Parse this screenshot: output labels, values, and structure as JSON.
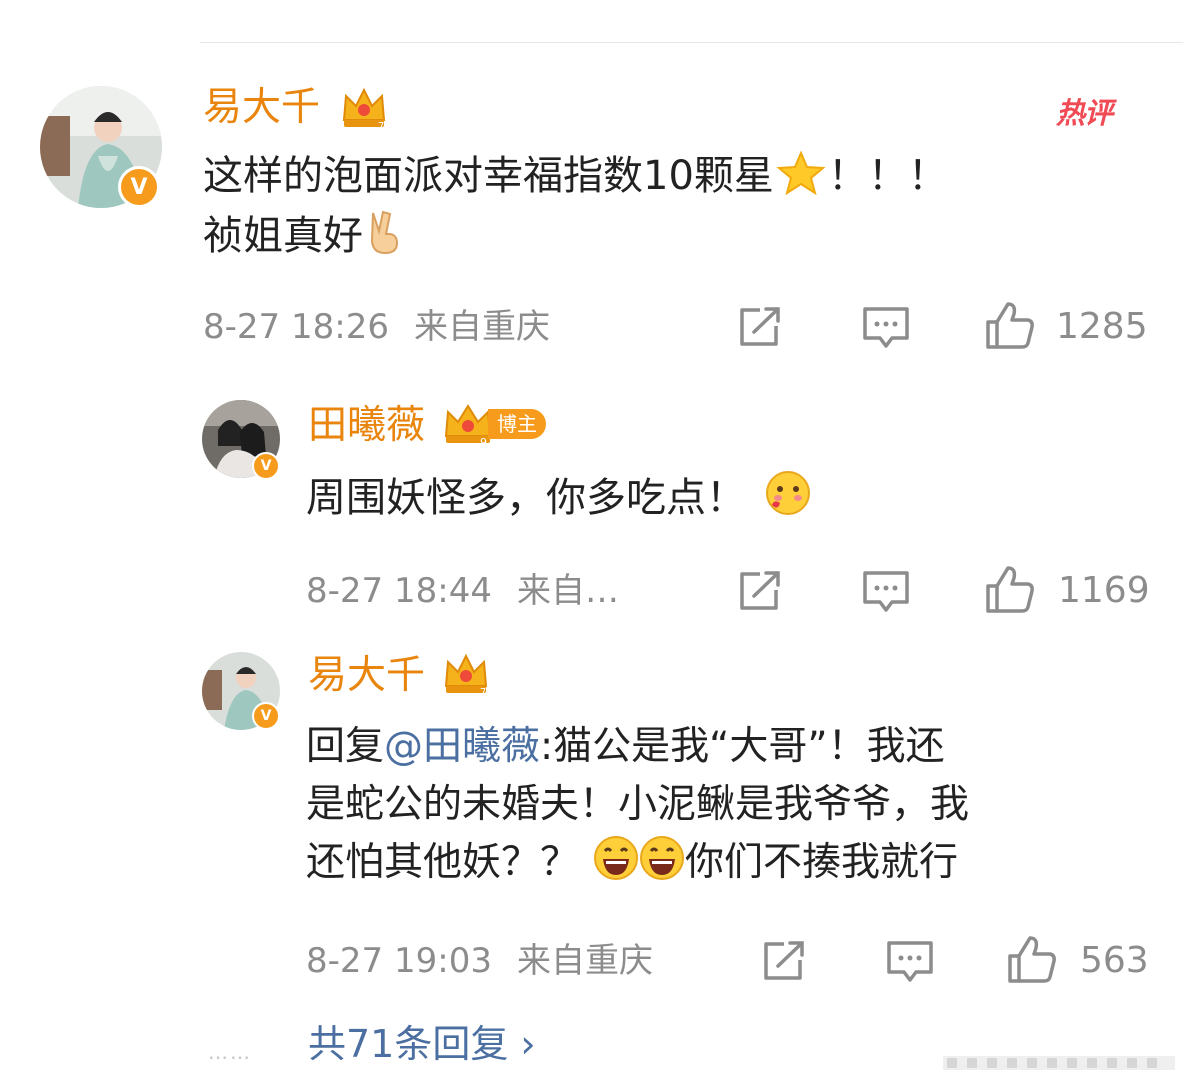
{
  "hot_label": "热评",
  "comment": {
    "author": "易大千",
    "line1": "这样的泡面派对幸福指数10颗星",
    "line1_tail": "！！！",
    "line2": "祯姐真好",
    "time": "8-27 18:26",
    "location": "来自重庆",
    "likes": "1285"
  },
  "replies": [
    {
      "author": "田曦薇",
      "badge": "博主",
      "text": "周围妖怪多，你多吃点！",
      "time": "8-27 18:44",
      "location": "来自…",
      "likes": "1169"
    },
    {
      "author": "易大千",
      "reply_prefix": "回复",
      "mention": "@田曦薇",
      "line1": ":猫公是我“大哥”！我还",
      "line2": "是蛇公的未婚夫！小泥鳅是我爷爷，我",
      "line3": "还怕其他妖？？",
      "line3_tail": "你们不揍我就行",
      "time": "8-27 19:03",
      "location": "来自重庆",
      "likes": "563"
    }
  ],
  "more_replies": "共71条回复 ›",
  "dots": "……",
  "icons": [
    "crown-icon",
    "star-emoji-icon",
    "victory-hand-icon",
    "share-icon",
    "comment-icon",
    "like-icon",
    "blush-emoji-icon",
    "laugh-emoji-icon",
    "verified-badge-icon"
  ],
  "colors": {
    "name": "#e9850d",
    "mention": "#4a6fa0",
    "meta": "#8c8c8c",
    "hot": "#f04b55",
    "badge": "#f79b1c"
  }
}
